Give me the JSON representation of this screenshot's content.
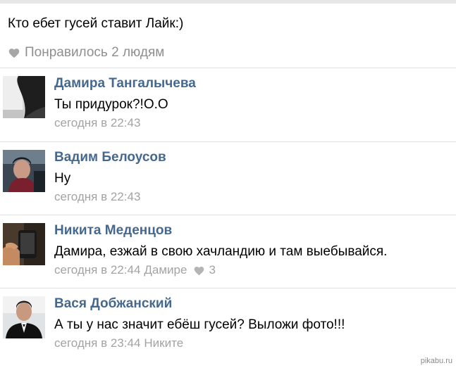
{
  "post": {
    "text": "Кто ебет гусей ставит Лайк:)",
    "likes_text": "Понравилось 2 людям",
    "likes_icon": "heart-icon"
  },
  "comments": [
    {
      "name": "Дамира Тангалычева",
      "text": "Ты придурок?!О.О",
      "time": "сегодня в 22:43",
      "reply_to": "",
      "likes": ""
    },
    {
      "name": "Вадим Белоусов",
      "text": "Ну",
      "time": "сегодня в 22:43",
      "reply_to": "",
      "likes": ""
    },
    {
      "name": "Никита Меденцов",
      "text": "Дамира, езжай в свою хачландию и там выебывайся.",
      "time": "сегодня в 22:44",
      "reply_to": "Дамире",
      "likes": "3"
    },
    {
      "name": "Вася Добжанский",
      "text": "А ты у нас значит ебёш гусей? Выложи фото!!!",
      "time": "сегодня в 23:44",
      "reply_to": "Никите",
      "likes": ""
    }
  ],
  "colors": {
    "author_name": "#45688e",
    "meta_text": "#a3a3a3",
    "divider": "#e0e0e0"
  },
  "watermark": "pikabu.ru"
}
